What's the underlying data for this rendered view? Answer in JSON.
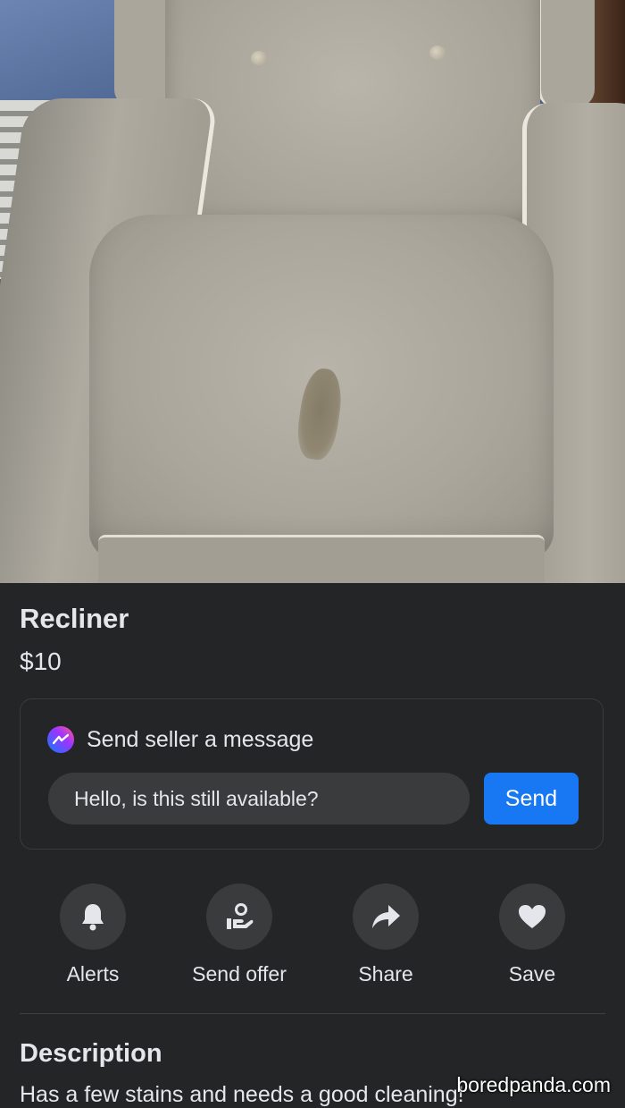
{
  "listing": {
    "title": "Recliner",
    "price": "$10"
  },
  "message_card": {
    "icon": "messenger-icon",
    "title": "Send seller a message",
    "input_value": "Hello, is this still available?",
    "send_label": "Send"
  },
  "actions": [
    {
      "label": "Alerts",
      "icon": "bell-icon"
    },
    {
      "label": "Send offer",
      "icon": "offer-icon"
    },
    {
      "label": "Share",
      "icon": "share-icon"
    },
    {
      "label": "Save",
      "icon": "heart-icon"
    }
  ],
  "description": {
    "title": "Description",
    "text": "Has a few stains and needs a good cleaning!"
  },
  "watermark": "boredpanda.com",
  "colors": {
    "background": "#242526",
    "surface": "#3a3b3c",
    "accent": "#1877f2",
    "text": "#e4e6eb"
  }
}
